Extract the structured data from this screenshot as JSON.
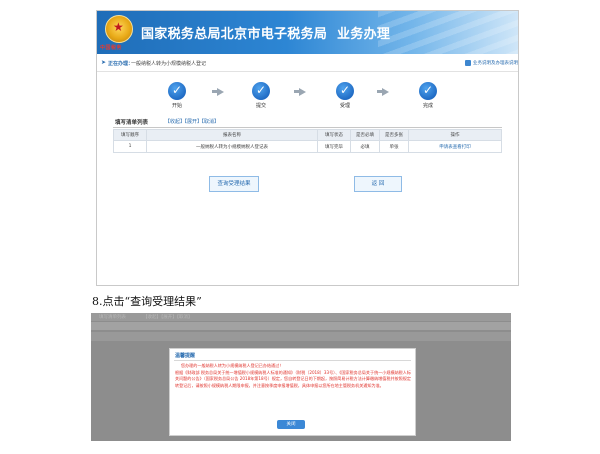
{
  "screenshot1": {
    "banner": {
      "title": "国家税务总局北京市电子税务局",
      "subtitle": "业务办理",
      "emblem_text": "中国税务"
    },
    "breadcrumb": {
      "label": "正在办理：",
      "value": "一般纳税人转为小规模纳税人登记",
      "help_link": "业务说明及办理表说明"
    },
    "steps": [
      {
        "label": "开始",
        "state": "done"
      },
      {
        "label": "提交",
        "state": "done"
      },
      {
        "label": "受理",
        "state": "done"
      },
      {
        "label": "完成",
        "state": "done"
      }
    ],
    "list": {
      "title": "填写清单列表",
      "actions": [
        "【收起】",
        "【展开】",
        "【取消】"
      ],
      "columns": [
        "填写顺序",
        "报表名称",
        "填写状态",
        "是否必填",
        "是否多张",
        "操作"
      ],
      "rows": [
        [
          "1",
          "一般纳税人转为小规模纳税人登记表",
          "填写完毕",
          "必填",
          "单张",
          "申请表查看打印"
        ]
      ]
    },
    "buttons": {
      "query": "查询受理结果",
      "back": "返  回"
    }
  },
  "caption": "8.点击“查询受理结果”",
  "screenshot2": {
    "background": {
      "list_title": "填写清单列表",
      "list_actions": "【收起】【展开】【取消】"
    },
    "dialog": {
      "title": "温馨提醒",
      "lines": [
        "您办理的一般纳税人转为小规模纳税人登记已办结通过！",
        "根据《财政部 税务总局关于统一增值税小规模纳税人标准的通知》（财税〔2018〕33号）、《国家税务总局关于统一小规模纳税人标准等有",
        "关问题的公告》（国家税务总局公告 2018年第18号）规定，您自转登记日的下期起，按照简易计税方法计算缴纳增值税并按照规定申报，",
        "转登记后，请按照小规模纳税人期限申报，并注意按季度申报增值税，具体申报以您所在地主管税务机关通知为准。"
      ],
      "ok_label": "关闭"
    }
  },
  "colors": {
    "brand_blue": "#2a6db0",
    "alert_red": "#e0322b",
    "overlay_gray": "#8d8d8d"
  }
}
